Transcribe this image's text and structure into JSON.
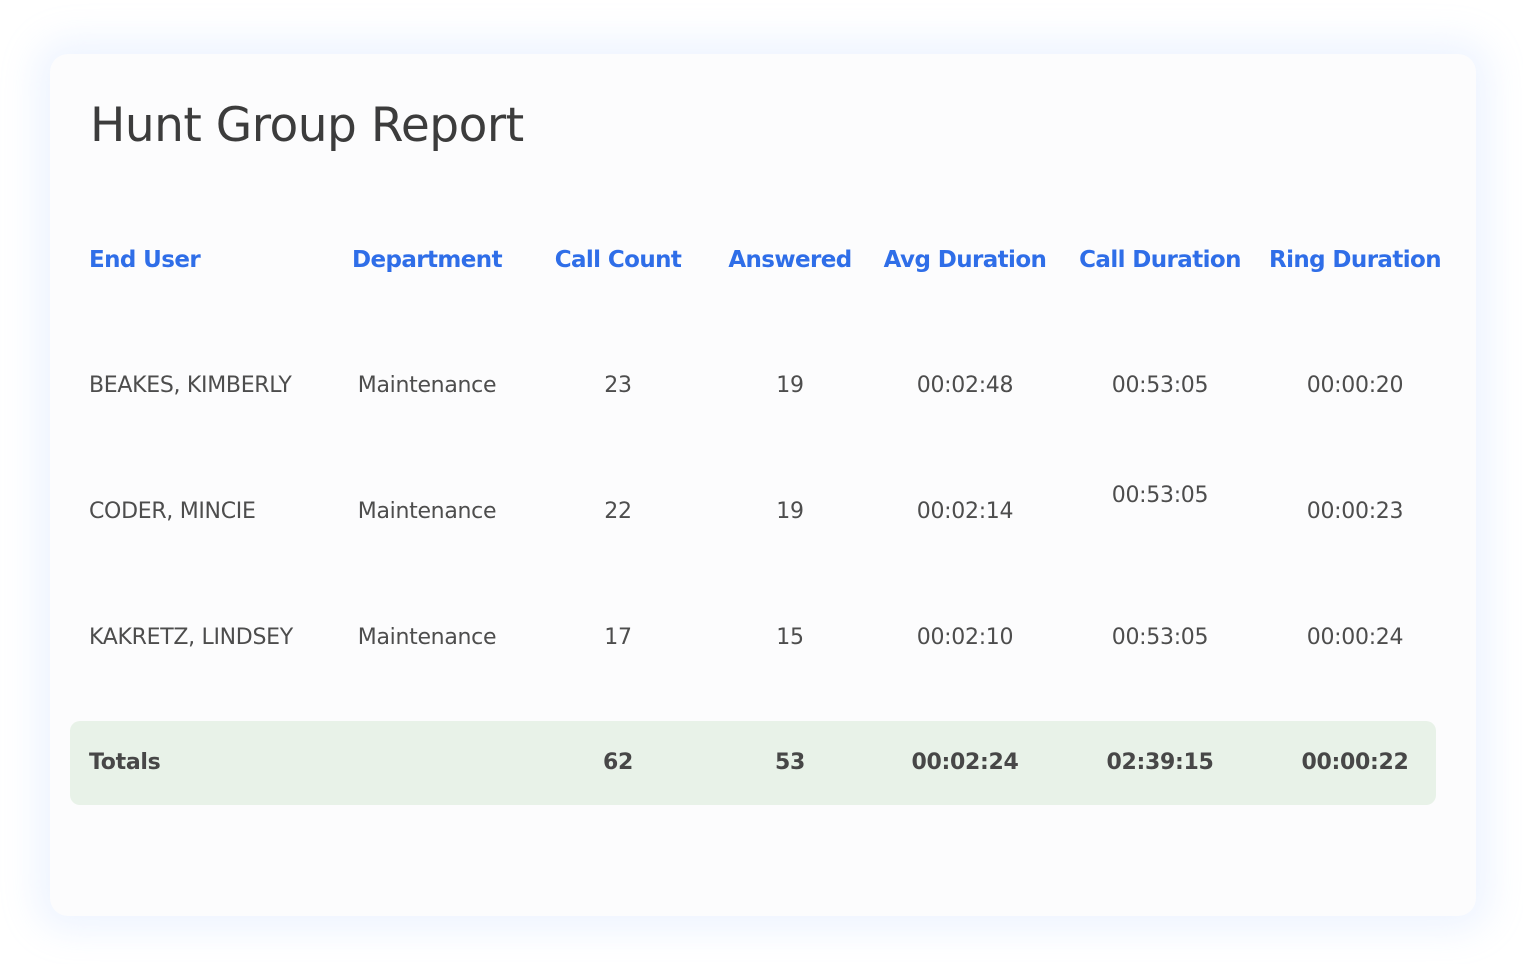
{
  "report": {
    "title": "Hunt Group Report"
  },
  "table": {
    "headers": {
      "end_user": "End User",
      "department": "Department",
      "call_count": "Call Count",
      "answered": "Answered",
      "avg_duration": "Avg Duration",
      "call_duration": "Call Duration",
      "ring_duration": "Ring Duration"
    },
    "rows": [
      {
        "end_user": "BEAKES, KIMBERLY",
        "department": "Maintenance",
        "call_count": "23",
        "answered": "19",
        "avg_duration": "00:02:48",
        "call_duration": "00:53:05",
        "ring_duration": "00:00:20"
      },
      {
        "end_user": "CODER, MINCIE",
        "department": "Maintenance",
        "call_count": "22",
        "answered": "19",
        "avg_duration": "00:02:14",
        "call_duration": "00:53:05",
        "ring_duration": "00:00:23"
      },
      {
        "end_user": "KAKRETZ, LINDSEY",
        "department": "Maintenance",
        "call_count": "17",
        "answered": "15",
        "avg_duration": "00:02:10",
        "call_duration": "00:53:05",
        "ring_duration": "00:00:24"
      }
    ],
    "totals": {
      "label": "Totals",
      "call_count": "62",
      "answered": "53",
      "avg_duration": "00:02:24",
      "call_duration": "02:39:15",
      "ring_duration": "00:00:22"
    }
  },
  "colors": {
    "header_text": "#2f6ee8",
    "body_text": "#4d4d4d",
    "title_text": "#3c3c3c",
    "totals_background": "#e8f2e8",
    "card_background": "#fcfcfd"
  }
}
